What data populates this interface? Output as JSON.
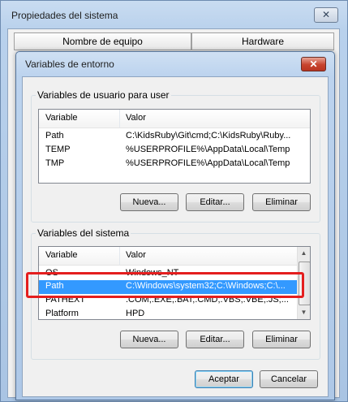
{
  "background_window": {
    "title": "Propiedades del sistema",
    "close_glyph": "✕",
    "tabs": [
      "Nombre de equipo",
      "Hardware"
    ]
  },
  "dialog": {
    "title": "Variables de entorno",
    "close_glyph": "✕",
    "user_vars": {
      "group_label": "Variables de usuario para user",
      "columns": [
        "Variable",
        "Valor"
      ],
      "rows": [
        {
          "name": "Path",
          "value": "C:\\KidsRuby\\Git\\cmd;C:\\KidsRuby\\Ruby..."
        },
        {
          "name": "TEMP",
          "value": "%USERPROFILE%\\AppData\\Local\\Temp"
        },
        {
          "name": "TMP",
          "value": "%USERPROFILE%\\AppData\\Local\\Temp"
        }
      ],
      "buttons": {
        "new": "Nueva...",
        "edit": "Editar...",
        "delete": "Eliminar"
      }
    },
    "system_vars": {
      "group_label": "Variables del sistema",
      "columns": [
        "Variable",
        "Valor"
      ],
      "rows": [
        {
          "name": "OS",
          "value": "Windows_NT"
        },
        {
          "name": "Path",
          "value": "C:\\Windows\\system32;C:\\Windows;C:\\..."
        },
        {
          "name": "PATHEXT",
          "value": ".COM;.EXE;.BAT;.CMD;.VBS;.VBE;.JS;..."
        },
        {
          "name": "Platform",
          "value": "HPD"
        }
      ],
      "selected_row": "Path",
      "buttons": {
        "new": "Nueva...",
        "edit": "Editar...",
        "delete": "Eliminar"
      }
    },
    "footer": {
      "accept": "Aceptar",
      "cancel": "Cancelar"
    }
  },
  "icons": {
    "scroll_up": "scroll-up-arrow-icon",
    "scroll_down": "scroll-down-arrow-icon"
  },
  "colors": {
    "selection": "#3399ff",
    "highlight_box": "#e41e1e",
    "close_button": "#c7432d"
  }
}
